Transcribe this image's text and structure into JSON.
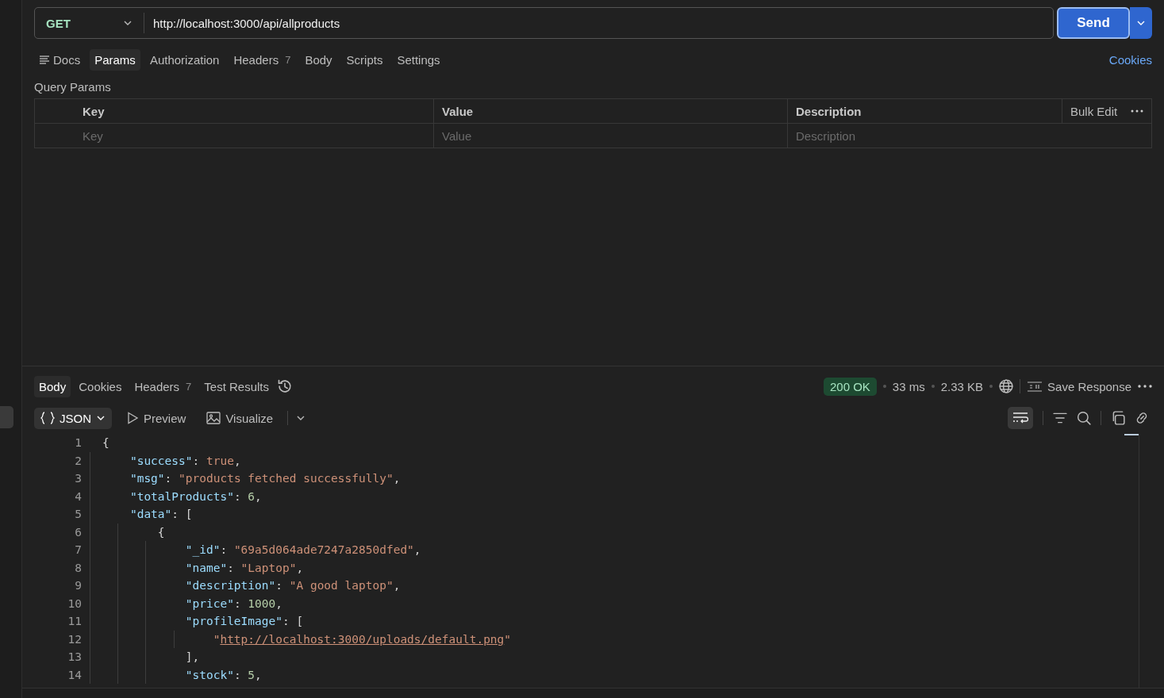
{
  "request": {
    "method": "GET",
    "url": "http://localhost:3000/api/allproducts",
    "send": "Send"
  },
  "request_tabs": [
    {
      "label": "Docs",
      "selected": false,
      "kind": "docs"
    },
    {
      "label": "Params",
      "selected": true
    },
    {
      "label": "Authorization",
      "selected": false
    },
    {
      "label": "Headers",
      "count": "7",
      "selected": false
    },
    {
      "label": "Body",
      "selected": false
    },
    {
      "label": "Scripts",
      "selected": false
    },
    {
      "label": "Settings",
      "selected": false
    }
  ],
  "cookies_link": "Cookies",
  "query_params": {
    "title": "Query Params",
    "columns": [
      "Key",
      "Value",
      "Description"
    ],
    "bulk_edit": "Bulk Edit",
    "placeholders": [
      "Key",
      "Value",
      "Description"
    ]
  },
  "response_tabs": [
    {
      "label": "Body",
      "selected": true
    },
    {
      "label": "Cookies",
      "selected": false
    },
    {
      "label": "Headers",
      "count": "7",
      "selected": false
    },
    {
      "label": "Test Results",
      "selected": false
    }
  ],
  "response_meta": {
    "status": "200 OK",
    "time": "33 ms",
    "size": "2.33 KB",
    "save": "Save Response"
  },
  "view_modes": [
    {
      "label": "JSON",
      "kind": "json",
      "selected": true
    },
    {
      "label": "Preview",
      "kind": "preview",
      "selected": false
    },
    {
      "label": "Visualize",
      "kind": "visualize",
      "selected": false
    }
  ],
  "code": [
    {
      "number": "1",
      "tokens": [
        {
          "kind": "punct",
          "text": "{"
        }
      ]
    },
    {
      "number": "2",
      "tokens": [
        {
          "kind": "key",
          "text": "    \"success\""
        },
        {
          "kind": "punct",
          "text": ": "
        },
        {
          "kind": "bool",
          "text": "true"
        },
        {
          "kind": "punct",
          "text": ","
        }
      ]
    },
    {
      "number": "3",
      "tokens": [
        {
          "kind": "key",
          "text": "    \"msg\""
        },
        {
          "kind": "punct",
          "text": ": "
        },
        {
          "kind": "string",
          "text": "\"products fetched successfully\""
        },
        {
          "kind": "punct",
          "text": ","
        }
      ]
    },
    {
      "number": "4",
      "tokens": [
        {
          "kind": "key",
          "text": "    \"totalProducts\""
        },
        {
          "kind": "punct",
          "text": ": "
        },
        {
          "kind": "number",
          "text": "6"
        },
        {
          "kind": "punct",
          "text": ","
        }
      ]
    },
    {
      "number": "5",
      "tokens": [
        {
          "kind": "key",
          "text": "    \"data\""
        },
        {
          "kind": "punct",
          "text": ": ["
        }
      ]
    },
    {
      "number": "6",
      "tokens": [
        {
          "kind": "punct",
          "text": "        {"
        }
      ]
    },
    {
      "number": "7",
      "tokens": [
        {
          "kind": "key",
          "text": "            \"_id\""
        },
        {
          "kind": "punct",
          "text": ": "
        },
        {
          "kind": "string",
          "text": "\"69a5d064ade7247a2850dfed\""
        },
        {
          "kind": "punct",
          "text": ","
        }
      ]
    },
    {
      "number": "8",
      "tokens": [
        {
          "kind": "key",
          "text": "            \"name\""
        },
        {
          "kind": "punct",
          "text": ": "
        },
        {
          "kind": "string",
          "text": "\"Laptop\""
        },
        {
          "kind": "punct",
          "text": ","
        }
      ]
    },
    {
      "number": "9",
      "tokens": [
        {
          "kind": "key",
          "text": "            \"description\""
        },
        {
          "kind": "punct",
          "text": ": "
        },
        {
          "kind": "string",
          "text": "\"A good laptop\""
        },
        {
          "kind": "punct",
          "text": ","
        }
      ]
    },
    {
      "number": "10",
      "tokens": [
        {
          "kind": "key",
          "text": "            \"price\""
        },
        {
          "kind": "punct",
          "text": ": "
        },
        {
          "kind": "number",
          "text": "1000"
        },
        {
          "kind": "punct",
          "text": ","
        }
      ]
    },
    {
      "number": "11",
      "tokens": [
        {
          "kind": "key",
          "text": "            \"profileImage\""
        },
        {
          "kind": "punct",
          "text": ": ["
        }
      ]
    },
    {
      "number": "12",
      "tokens": [
        {
          "kind": "string",
          "text": "                \""
        },
        {
          "kind": "link",
          "text": "http://localhost:3000/uploads/default.png"
        },
        {
          "kind": "string",
          "text": "\""
        }
      ]
    },
    {
      "number": "13",
      "tokens": [
        {
          "kind": "punct",
          "text": "            ],"
        }
      ]
    },
    {
      "number": "14",
      "tokens": [
        {
          "kind": "key",
          "text": "            \"stock\""
        },
        {
          "kind": "punct",
          "text": ": "
        },
        {
          "kind": "number",
          "text": "5"
        },
        {
          "kind": "punct",
          "text": ","
        }
      ]
    }
  ]
}
